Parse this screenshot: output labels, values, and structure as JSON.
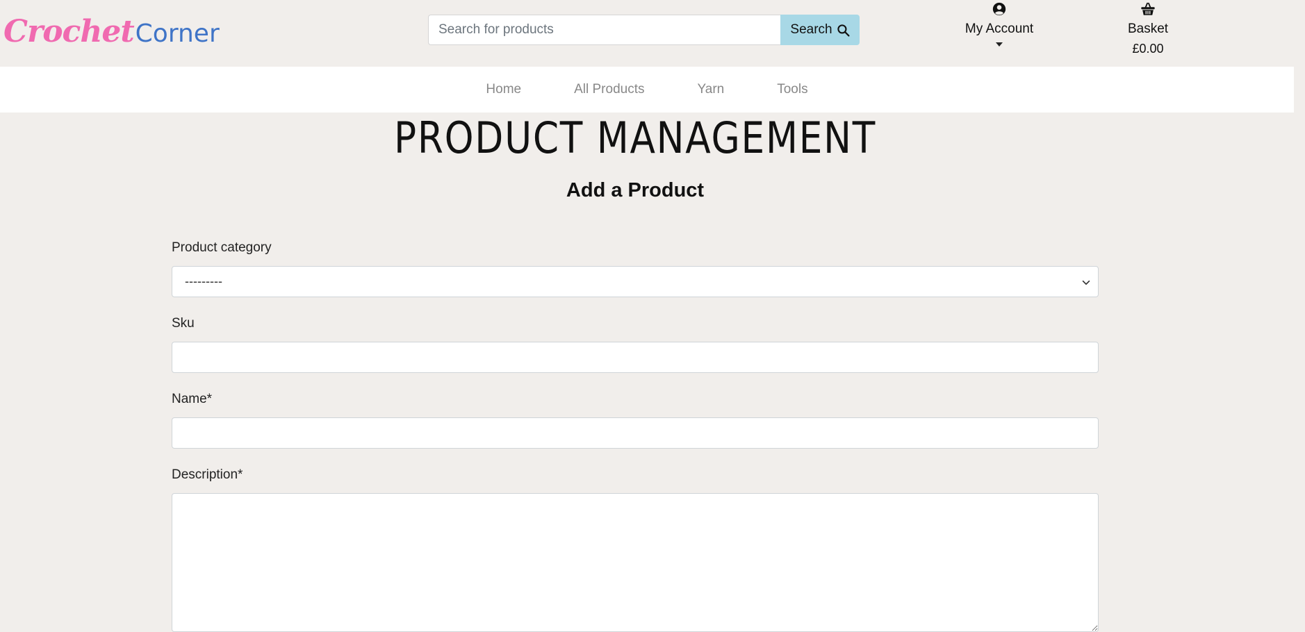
{
  "brand": {
    "name_part1": "Crochet",
    "name_part2": "Corner",
    "primary_color": "#f06ab0",
    "secondary_color": "#3f74c7"
  },
  "search": {
    "placeholder": "Search for products",
    "value": "",
    "button_label": "Search",
    "button_color": "#a8d8e6"
  },
  "account": {
    "label": "My Account",
    "icon": "user-circle-icon"
  },
  "basket": {
    "label": "Basket",
    "total": "£0.00",
    "icon": "basket-icon"
  },
  "nav": {
    "items": [
      {
        "label": "Home"
      },
      {
        "label": "All Products"
      },
      {
        "label": "Yarn"
      },
      {
        "label": "Tools"
      }
    ]
  },
  "page": {
    "title": "PRODUCT MANAGEMENT",
    "subtitle": "Add a Product"
  },
  "form": {
    "category": {
      "label": "Product category",
      "selected": "---------"
    },
    "sku": {
      "label": "Sku",
      "value": ""
    },
    "name": {
      "label": "Name*",
      "value": ""
    },
    "description": {
      "label": "Description*",
      "value": ""
    }
  }
}
